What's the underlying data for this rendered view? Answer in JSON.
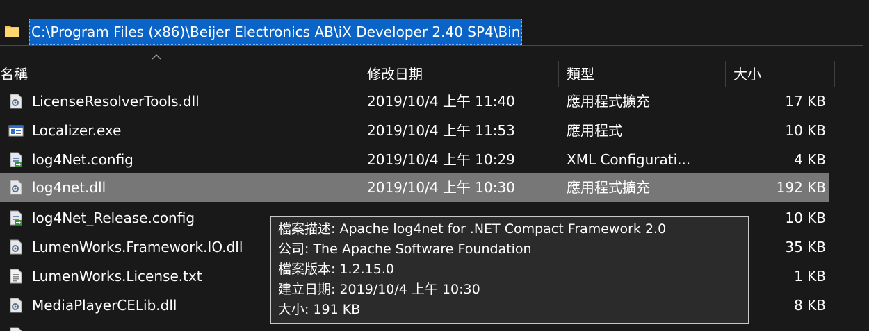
{
  "address_bar": {
    "path": "C:\\Program Files (x86)\\Beijer Electronics AB\\iX Developer 2.40 SP4\\Bin"
  },
  "columns": {
    "name": "名稱",
    "date": "修改日期",
    "type": "類型",
    "size": "大小"
  },
  "files": [
    {
      "name": "LicenseResolverTools.dll",
      "date": "2019/10/4 上午 11:40",
      "type": "應用程式擴充",
      "size": "17 KB",
      "icon": "dll-icon"
    },
    {
      "name": "Localizer.exe",
      "date": "2019/10/4 上午 11:53",
      "type": "應用程式",
      "size": "10 KB",
      "icon": "exe-icon"
    },
    {
      "name": "log4Net.config",
      "date": "2019/10/4 上午 10:29",
      "type": "XML Configurati...",
      "size": "4 KB",
      "icon": "config-icon"
    },
    {
      "name": "log4net.dll",
      "date": "2019/10/4 上午 10:30",
      "type": "應用程式擴充",
      "size": "192 KB",
      "icon": "dll-icon"
    },
    {
      "name": "log4Net_Release.config",
      "date": "",
      "type": "",
      "size": "10 KB",
      "icon": "config-icon"
    },
    {
      "name": "LumenWorks.Framework.IO.dll",
      "date": "",
      "type": "",
      "size": "35 KB",
      "icon": "dll-icon"
    },
    {
      "name": "LumenWorks.License.txt",
      "date": "",
      "type": "",
      "size": "1 KB",
      "icon": "txt-icon"
    },
    {
      "name": "MediaPlayerCELib.dll",
      "date": "",
      "type": "",
      "size": "8 KB",
      "icon": "dll-icon"
    }
  ],
  "tooltip": {
    "description": "檔案描述: Apache log4net for .NET Compact Framework 2.0",
    "company": "公司: The Apache Software Foundation",
    "version": "檔案版本: 1.2.15.0",
    "created": "建立日期: 2019/10/4 上午 10:30",
    "size": "大小: 191 KB"
  },
  "colors": {
    "background": "#191919",
    "selection": "#777777",
    "address_highlight": "#0a64c8",
    "tooltip_bg": "#2b2b2b"
  }
}
